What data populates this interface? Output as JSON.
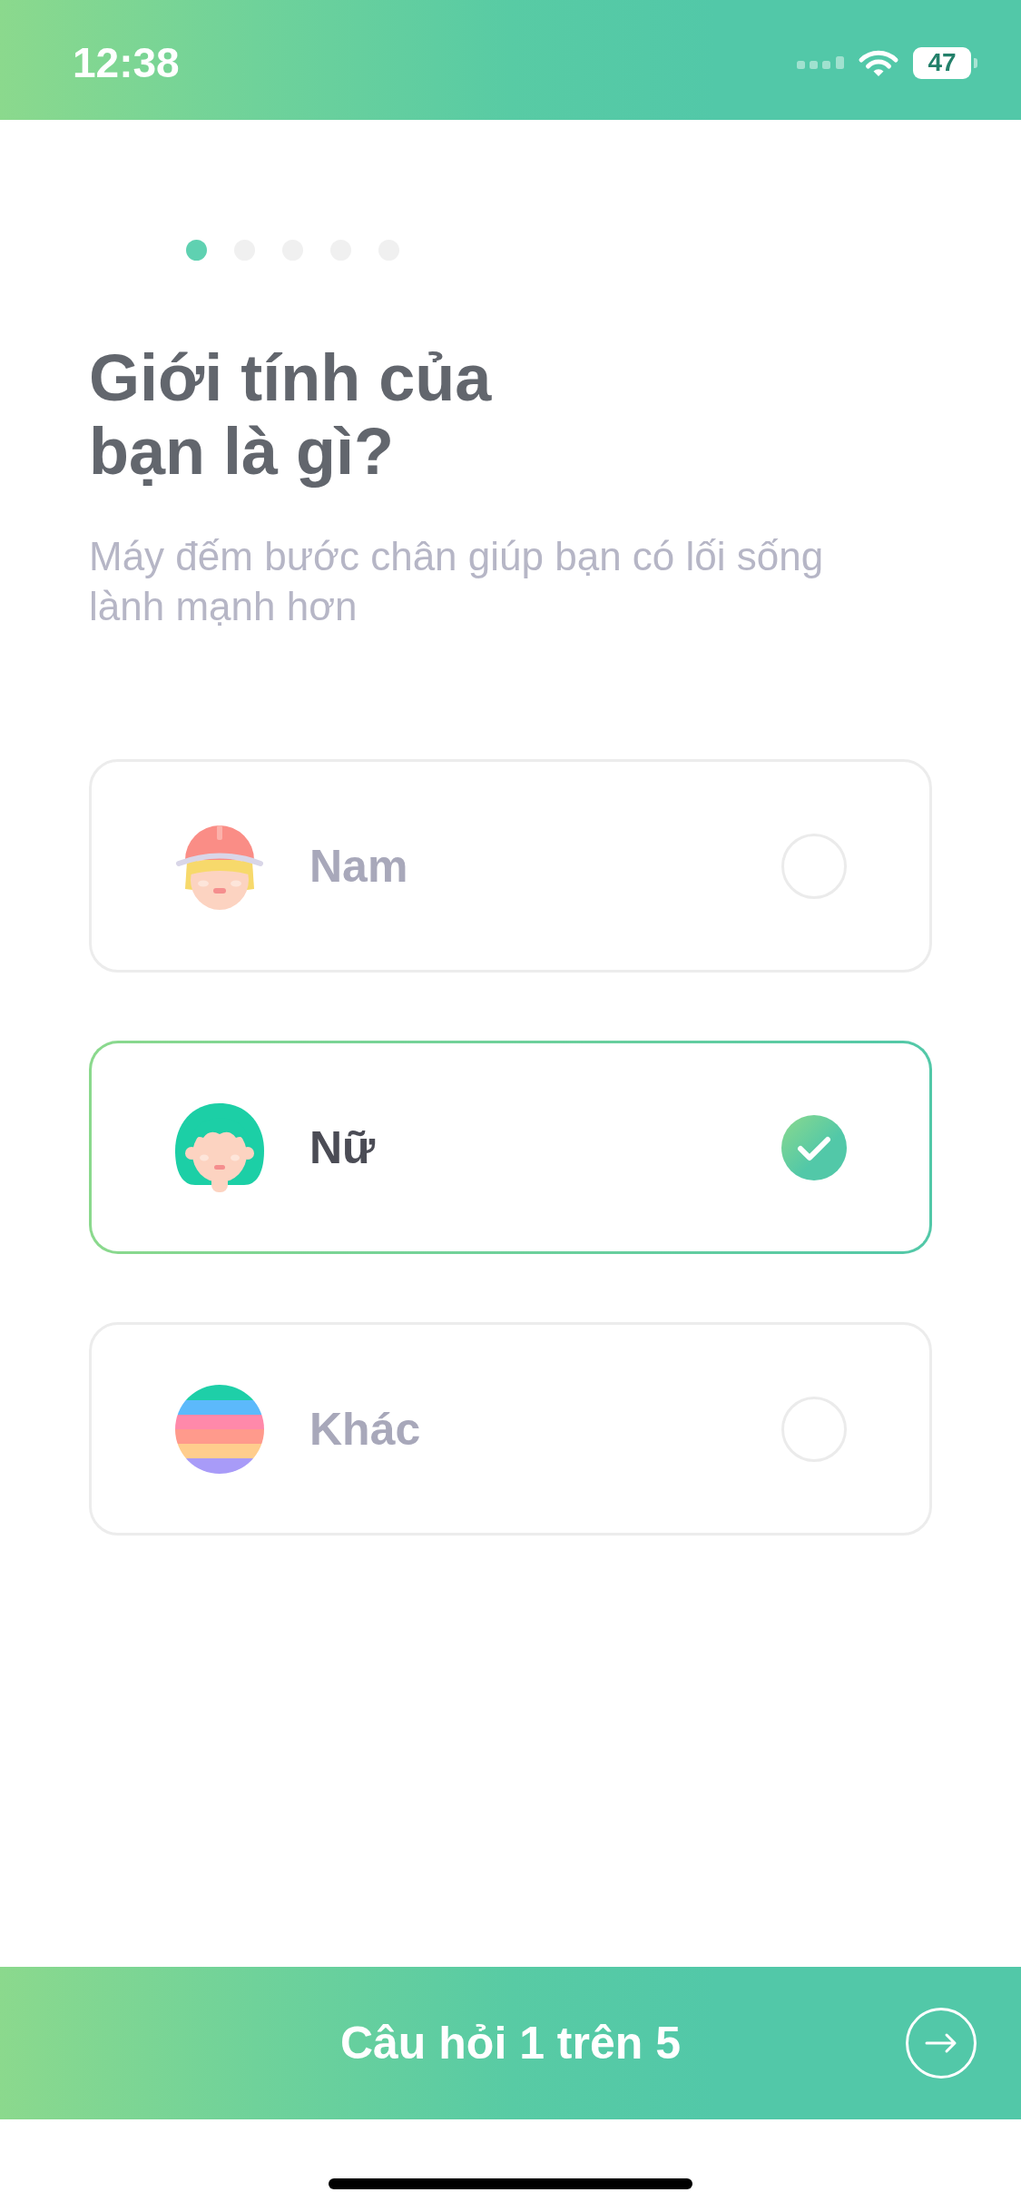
{
  "status_bar": {
    "time": "12:38",
    "battery": "47"
  },
  "progress_dots": [
    {
      "selected": true
    },
    {
      "selected": false
    },
    {
      "selected": false
    },
    {
      "selected": false
    },
    {
      "selected": false
    }
  ],
  "question": {
    "title": "Giới tính của bạn là gì?",
    "subtitle": "Máy đếm bước chân giúp bạn có lối sống lành mạnh hơn"
  },
  "options": [
    {
      "kind": "male",
      "label": "Nam",
      "selected": false
    },
    {
      "kind": "female",
      "label": "Nữ",
      "selected": true
    },
    {
      "kind": "other",
      "label": "Khác",
      "selected": false
    }
  ],
  "footer": {
    "counter": "Câu hỏi 1 trên 5"
  }
}
